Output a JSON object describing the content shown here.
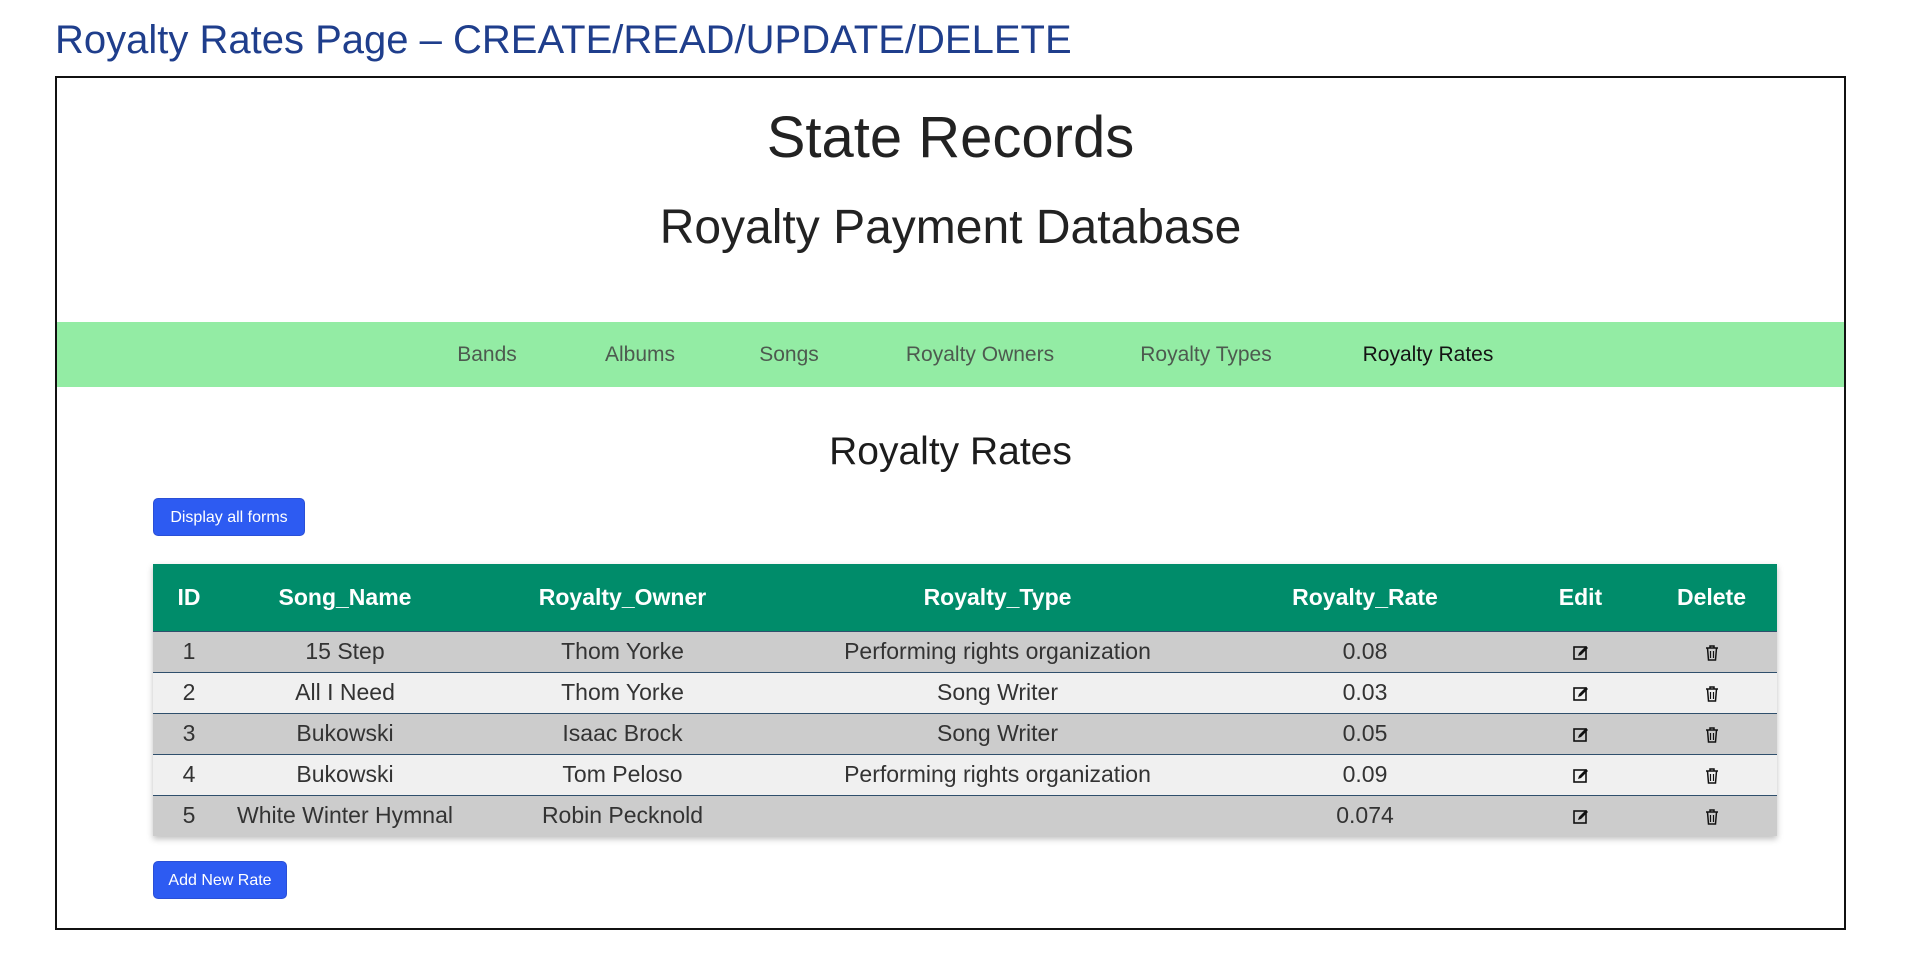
{
  "doc_title": "Royalty Rates Page – CREATE/READ/UPDATE/DELETE",
  "site": {
    "title": "State Records",
    "subtitle": "Royalty Payment Database"
  },
  "nav": {
    "items": [
      {
        "label": "Bands"
      },
      {
        "label": "Albums"
      },
      {
        "label": "Songs"
      },
      {
        "label": "Royalty Owners"
      },
      {
        "label": "Royalty Types"
      },
      {
        "label": "Royalty Rates",
        "active": true
      }
    ]
  },
  "main": {
    "title": "Royalty Rates",
    "display_forms_label": "Display all forms",
    "add_new_label": "Add New Rate"
  },
  "table": {
    "headers": [
      "ID",
      "Song_Name",
      "Royalty_Owner",
      "Royalty_Type",
      "Royalty_Rate",
      "Edit",
      "Delete"
    ],
    "rows": [
      {
        "id": "1",
        "song": "15 Step",
        "owner": "Thom Yorke",
        "type": "Performing rights organization",
        "rate": "0.08"
      },
      {
        "id": "2",
        "song": "All I Need",
        "owner": "Thom Yorke",
        "type": "Song Writer",
        "rate": "0.03"
      },
      {
        "id": "3",
        "song": "Bukowski",
        "owner": "Isaac Brock",
        "type": "Song Writer",
        "rate": "0.05"
      },
      {
        "id": "4",
        "song": "Bukowski",
        "owner": "Tom Peloso",
        "type": "Performing rights organization",
        "rate": "0.09"
      },
      {
        "id": "5",
        "song": "White Winter Hymnal",
        "owner": "Robin Pecknold",
        "type": "",
        "rate": "0.074"
      }
    ]
  },
  "icons": {
    "edit": "edit-icon",
    "delete": "trash-icon"
  },
  "colors": {
    "doc_title": "#1f3e8c",
    "navbar": "#93eca4",
    "table_header": "#008c6a",
    "button": "#2d5bf2"
  }
}
